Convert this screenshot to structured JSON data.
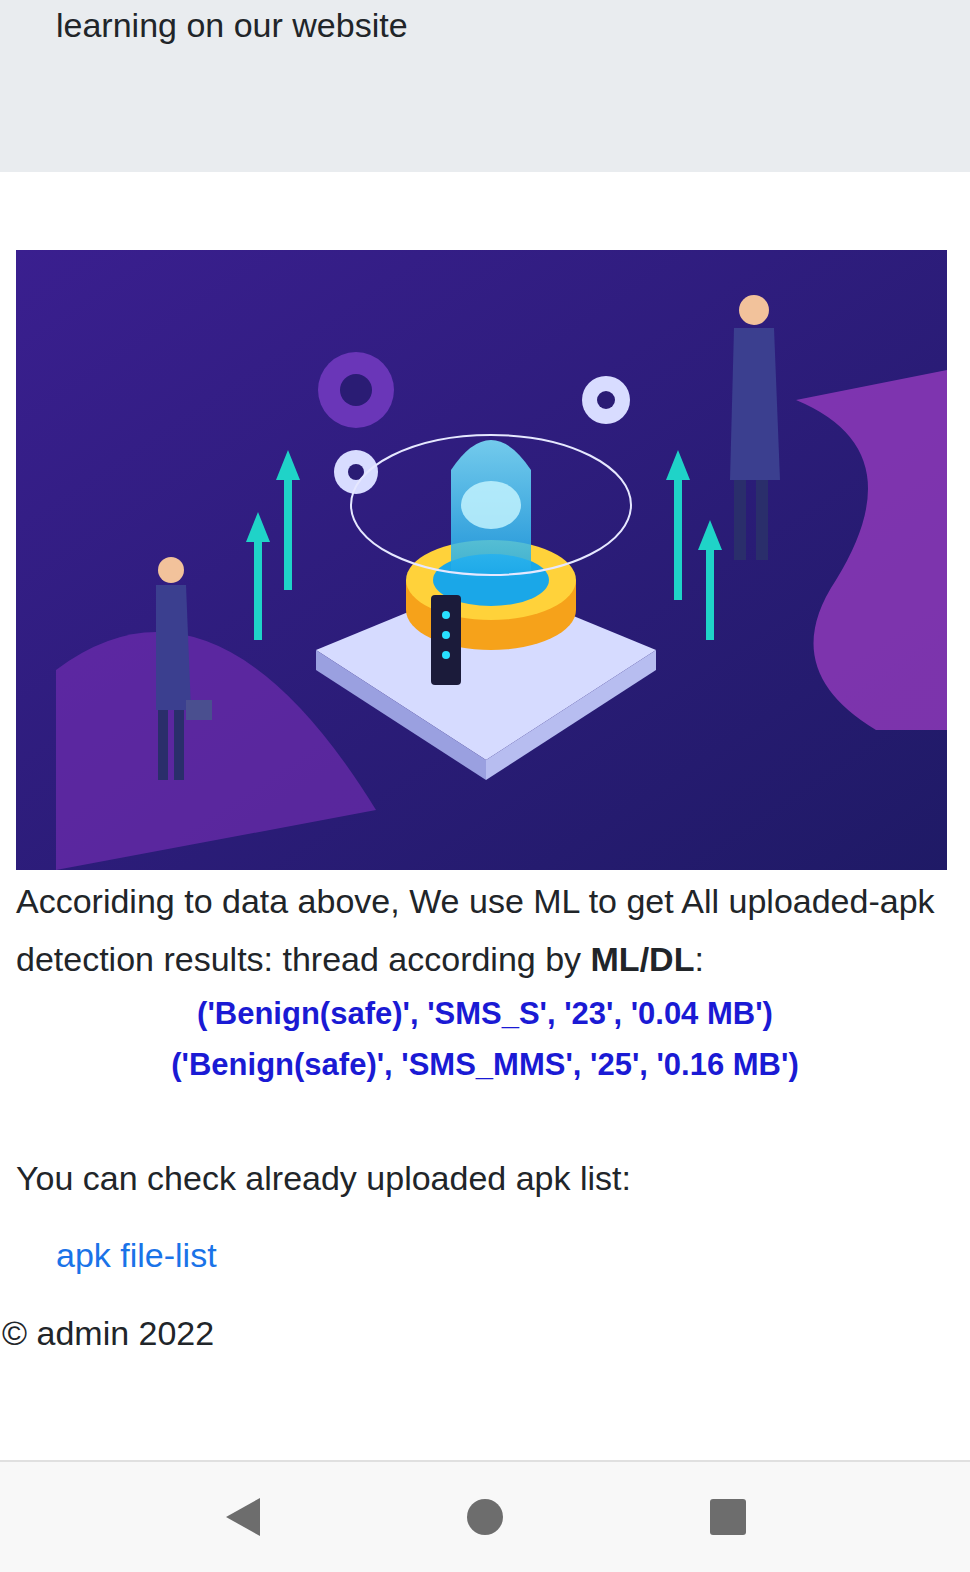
{
  "header": {
    "text": "learning on our website"
  },
  "intro": {
    "text": "Accoriding to data above, We use ML to get All uploaded-apk detection results: thread according by ",
    "bold": "ML/DL",
    "suffix": ":"
  },
  "results": [
    "('Benign(safe)', 'SMS_S', '23', '0.04 MB')",
    "('Benign(safe)', 'SMS_MMS', '25', '0.16 MB')"
  ],
  "list_prompt": "You can check already uploaded apk list:",
  "link": {
    "label": "apk file-list"
  },
  "footer": {
    "text": "© admin 2022"
  }
}
